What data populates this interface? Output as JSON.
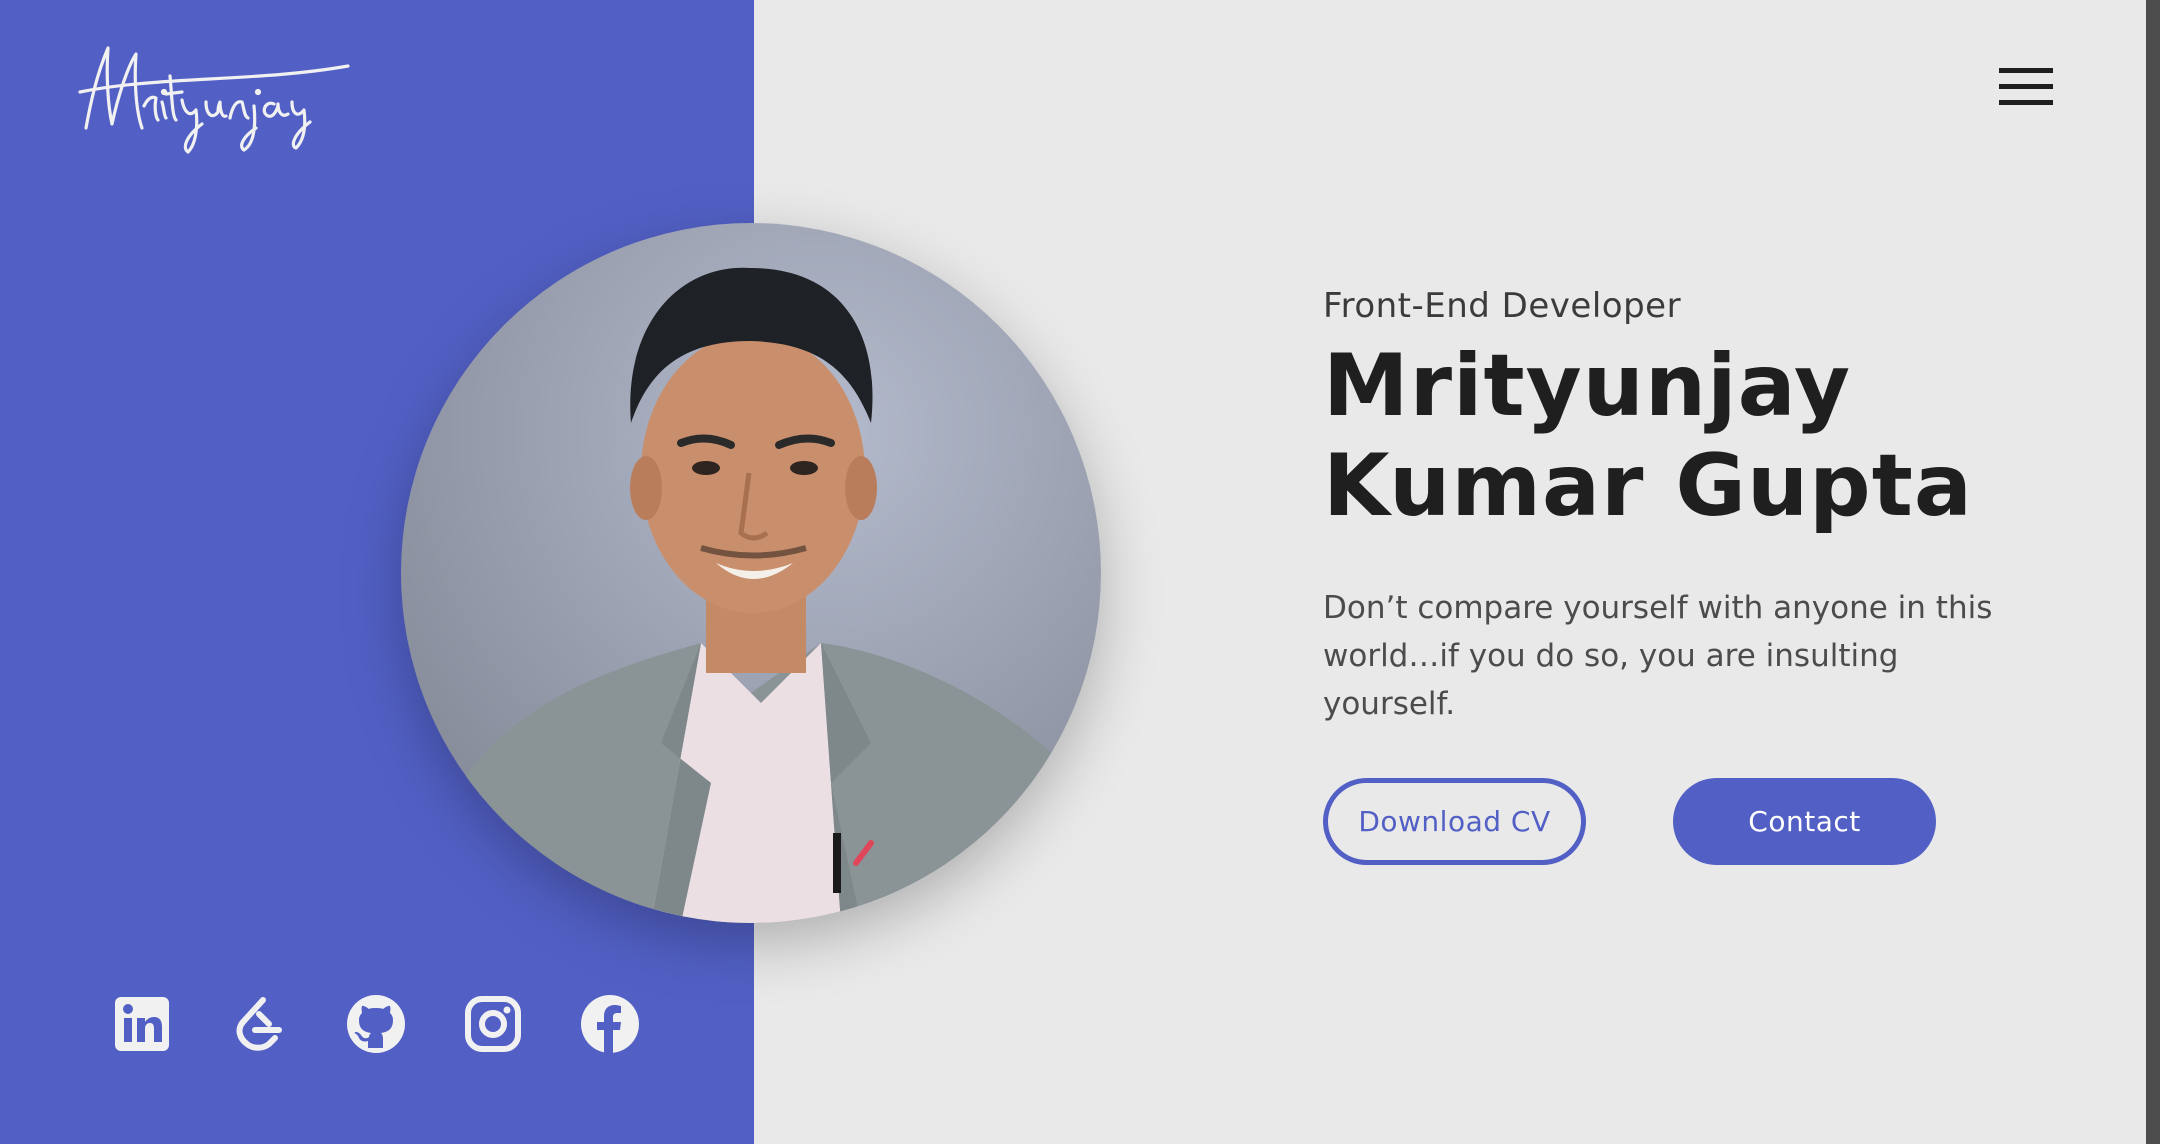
{
  "brand": {
    "logo_text": "Mrityunjay"
  },
  "nav": {
    "menu_icon": "hamburger-icon"
  },
  "hero": {
    "role": "Front-End Developer",
    "name_line1": "Mrityunjay",
    "name_line2": "Kumar Gupta",
    "quote": "Don’t compare yourself with anyone in this world…if you do so, you are insulting yourself.",
    "download_cv_label": "Download CV",
    "contact_label": "Contact"
  },
  "socials": [
    {
      "icon": "linkedin-icon"
    },
    {
      "icon": "leetcode-icon"
    },
    {
      "icon": "github-icon"
    },
    {
      "icon": "instagram-icon"
    },
    {
      "icon": "facebook-icon"
    }
  ],
  "colors": {
    "accent": "#5260c5",
    "background": "#e9e9e9",
    "heading": "#1f1f1f",
    "body_text": "#4c4c4c"
  }
}
